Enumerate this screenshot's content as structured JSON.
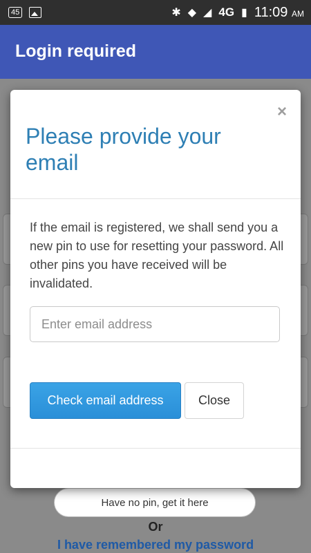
{
  "status_bar": {
    "badge": "45",
    "network": "4G",
    "time": "11:09",
    "ampm": "AM"
  },
  "app_bar": {
    "title": "Login required"
  },
  "background": {
    "pin_button_label": "Have no pin, get it here",
    "or_label": "Or",
    "remembered_link": "I have remembered my password"
  },
  "modal": {
    "close_symbol": "×",
    "title": "Please provide your email",
    "body": "If the email is registered, we shall send you a new pin to use for resetting your password. All other pins you have received will be invalidated.",
    "email_placeholder": "Enter email address",
    "email_value": "",
    "primary_button": "Check email address",
    "close_button": "Close"
  },
  "colors": {
    "app_bar": "#3f57b6",
    "primary_button": "#2a8fd8",
    "title_text": "#2e7fb4"
  }
}
